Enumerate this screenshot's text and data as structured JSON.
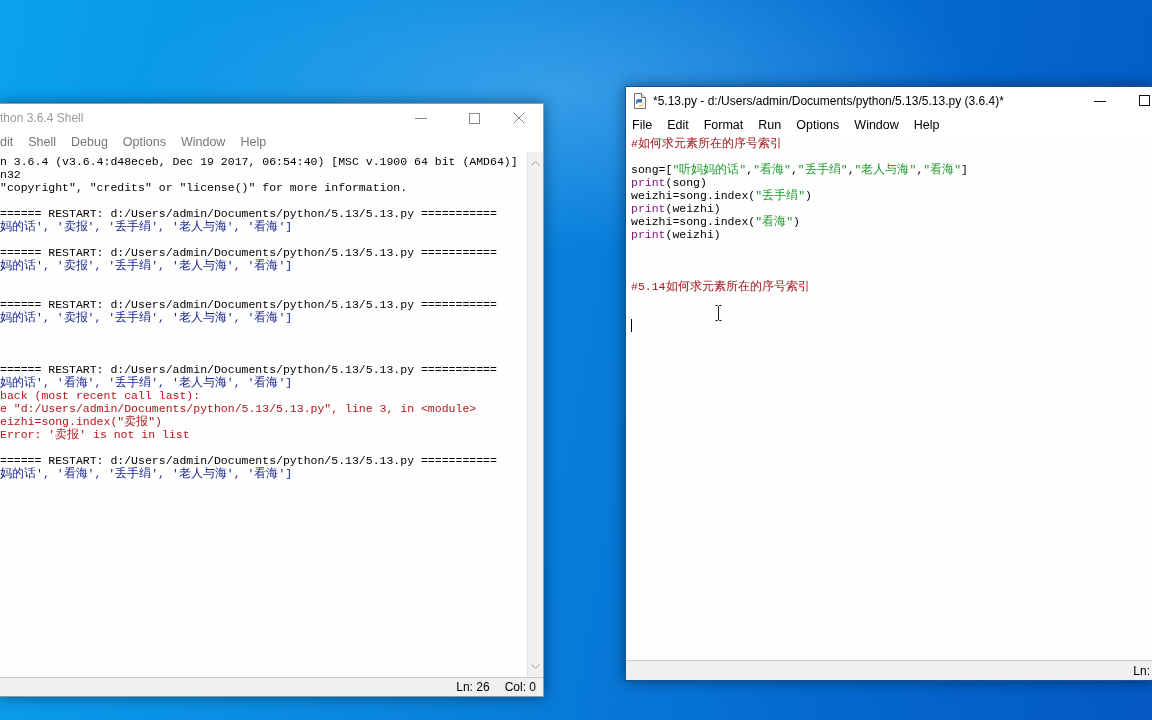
{
  "shell_window": {
    "title": "thon 3.6.4 Shell",
    "active": false,
    "menu": [
      "dit",
      "Shell",
      "Debug",
      "Options",
      "Window",
      "Help"
    ],
    "lines": [
      {
        "kind": "plain",
        "text": "n 3.6.4 (v3.6.4:d48eceb, Dec 19 2017, 06:54:40) [MSC v.1900 64 bit (AMD64)]"
      },
      {
        "kind": "plain",
        "text": "n32"
      },
      {
        "kind": "plain",
        "text": "\"copyright\", \"credits\" or \"license()\" for more information."
      },
      {
        "kind": "blank"
      },
      {
        "kind": "plain",
        "text": "====== RESTART: d:/Users/admin/Documents/python/5.13/5.13.py ==========="
      },
      {
        "kind": "stdout",
        "text": "妈的话', '卖报', '丢手绢', '老人与海', '看海']"
      },
      {
        "kind": "blank"
      },
      {
        "kind": "plain",
        "text": "====== RESTART: d:/Users/admin/Documents/python/5.13/5.13.py ==========="
      },
      {
        "kind": "stdout",
        "text": "妈的话', '卖报', '丢手绢', '老人与海', '看海']"
      },
      {
        "kind": "blank"
      },
      {
        "kind": "blank"
      },
      {
        "kind": "plain",
        "text": "====== RESTART: d:/Users/admin/Documents/python/5.13/5.13.py ==========="
      },
      {
        "kind": "stdout",
        "text": "妈的话', '卖报', '丢手绢', '老人与海', '看海']"
      },
      {
        "kind": "blank"
      },
      {
        "kind": "blank"
      },
      {
        "kind": "blank"
      },
      {
        "kind": "plain",
        "text": "====== RESTART: d:/Users/admin/Documents/python/5.13/5.13.py ==========="
      },
      {
        "kind": "stdout",
        "text": "妈的话', '看海', '丢手绢', '老人与海', '看海']"
      },
      {
        "kind": "stderr",
        "text": "back (most recent call last):"
      },
      {
        "kind": "stderr",
        "text": "e \"d:/Users/admin/Documents/python/5.13/5.13.py\", line 3, in <module>"
      },
      {
        "kind": "stderr",
        "text": "eizhi=song.index(\"卖报\")"
      },
      {
        "kind": "stderr",
        "text": "Error: '卖报' is not in list"
      },
      {
        "kind": "blank"
      },
      {
        "kind": "plain",
        "text": "====== RESTART: d:/Users/admin/Documents/python/5.13/5.13.py ==========="
      },
      {
        "kind": "stdout",
        "text": "妈的话', '看海', '丢手绢', '老人与海', '看海']"
      }
    ],
    "status": [
      "Ln: 26",
      "Col: 0"
    ]
  },
  "editor_window": {
    "title": "*5.13.py - d:/Users/admin/Documents/python/5.13/5.13.py (3.6.4)*",
    "active": true,
    "menu": [
      "File",
      "Edit",
      "Format",
      "Run",
      "Options",
      "Window",
      "Help"
    ],
    "lines": [
      {
        "kind": "code",
        "tokens": [
          {
            "kind": "comment",
            "text": "#如何求元素所在的序号索引"
          }
        ]
      },
      {
        "kind": "blank"
      },
      {
        "kind": "code",
        "tokens": [
          {
            "kind": "plain",
            "text": "song=["
          },
          {
            "kind": "string",
            "text": "\"听妈妈的话\""
          },
          {
            "kind": "plain",
            "text": ","
          },
          {
            "kind": "string",
            "text": "\"看海\""
          },
          {
            "kind": "plain",
            "text": ","
          },
          {
            "kind": "string",
            "text": "\"丢手绢\""
          },
          {
            "kind": "plain",
            "text": ","
          },
          {
            "kind": "string",
            "text": "\"老人与海\""
          },
          {
            "kind": "plain",
            "text": ","
          },
          {
            "kind": "string",
            "text": "\"看海\""
          },
          {
            "kind": "plain",
            "text": "]"
          }
        ]
      },
      {
        "kind": "code",
        "tokens": [
          {
            "kind": "builtin",
            "text": "print"
          },
          {
            "kind": "plain",
            "text": "(song)"
          }
        ]
      },
      {
        "kind": "code",
        "tokens": [
          {
            "kind": "plain",
            "text": "weizhi=song.index("
          },
          {
            "kind": "string",
            "text": "\"丢手绢\""
          },
          {
            "kind": "plain",
            "text": ")"
          }
        ]
      },
      {
        "kind": "code",
        "tokens": [
          {
            "kind": "builtin",
            "text": "print"
          },
          {
            "kind": "plain",
            "text": "(weizhi)"
          }
        ]
      },
      {
        "kind": "code",
        "tokens": [
          {
            "kind": "plain",
            "text": "weizhi=song.index("
          },
          {
            "kind": "string",
            "text": "\"看海\""
          },
          {
            "kind": "plain",
            "text": ")"
          }
        ]
      },
      {
        "kind": "code",
        "tokens": [
          {
            "kind": "builtin",
            "text": "print"
          },
          {
            "kind": "plain",
            "text": "(weizhi)"
          }
        ]
      },
      {
        "kind": "blank"
      },
      {
        "kind": "blank"
      },
      {
        "kind": "blank"
      },
      {
        "kind": "code",
        "tokens": [
          {
            "kind": "comment",
            "text": "#5.14如何求元素所在的序号索引"
          }
        ]
      },
      {
        "kind": "blank"
      },
      {
        "kind": "blank"
      },
      {
        "kind": "caret"
      }
    ],
    "status": [
      "Ln:"
    ]
  }
}
